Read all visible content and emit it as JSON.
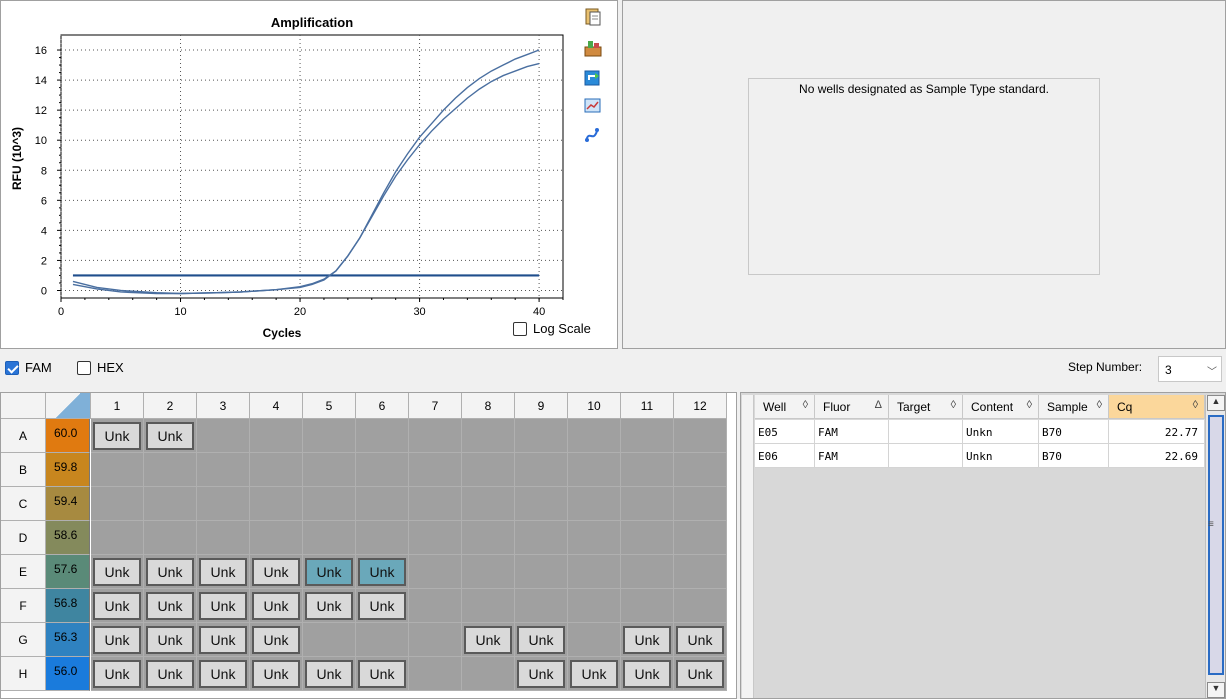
{
  "chart": {
    "title": "Amplification",
    "xlabel": "Cycles",
    "ylabel": "RFU (10^3)",
    "x_ticks": [
      "0",
      "10",
      "20",
      "30",
      "40"
    ],
    "y_ticks": [
      "0",
      "2",
      "4",
      "6",
      "8",
      "10",
      "12",
      "14",
      "16"
    ],
    "log_scale_label": "Log Scale",
    "log_scale_checked": false
  },
  "chart_data": {
    "type": "line",
    "title": "Amplification",
    "xlabel": "Cycles",
    "ylabel": "RFU (10^3)",
    "xlim": [
      0,
      42
    ],
    "ylim": [
      -0.5,
      17
    ],
    "grid": true,
    "threshold": 1.0,
    "series": [
      {
        "x": [
          1,
          3,
          5,
          8,
          10,
          13,
          15,
          18,
          20,
          21,
          22,
          23,
          24,
          25,
          26,
          27,
          28,
          29,
          30,
          31,
          32,
          33,
          34,
          35,
          36,
          37,
          38,
          39,
          40
        ],
        "values": [
          0.4,
          0.1,
          -0.1,
          -0.2,
          -0.2,
          -0.15,
          -0.1,
          0.05,
          0.2,
          0.4,
          0.7,
          1.3,
          2.3,
          3.5,
          5.0,
          6.5,
          7.9,
          9.1,
          10.2,
          11.1,
          12.0,
          12.8,
          13.5,
          14.1,
          14.6,
          15.0,
          15.4,
          15.7,
          16.0
        ]
      },
      {
        "x": [
          1,
          3,
          5,
          8,
          10,
          13,
          15,
          18,
          20,
          21,
          22,
          23,
          24,
          25,
          26,
          27,
          28,
          29,
          30,
          31,
          32,
          33,
          34,
          35,
          36,
          37,
          38,
          39,
          40
        ],
        "values": [
          0.6,
          0.2,
          0.0,
          -0.15,
          -0.2,
          -0.15,
          -0.1,
          0.05,
          0.25,
          0.45,
          0.75,
          1.3,
          2.3,
          3.5,
          4.9,
          6.3,
          7.6,
          8.7,
          9.7,
          10.6,
          11.4,
          12.1,
          12.8,
          13.4,
          13.9,
          14.3,
          14.6,
          14.9,
          15.1
        ]
      }
    ]
  },
  "toolbar_icons": [
    "copy-icon",
    "export-icon",
    "rotate-icon",
    "chart-zoom-icon",
    "trace-icon"
  ],
  "standard_curve": {
    "message": "No wells designated as Sample Type standard."
  },
  "fluors": [
    {
      "label": "FAM",
      "checked": true
    },
    {
      "label": "HEX",
      "checked": false
    }
  ],
  "step": {
    "label": "Step Number:",
    "value": "3"
  },
  "plate": {
    "columns": [
      "1",
      "2",
      "3",
      "4",
      "5",
      "6",
      "7",
      "8",
      "9",
      "10",
      "11",
      "12"
    ],
    "rows": [
      {
        "label": "A",
        "temp": "60.0",
        "color": "#e07a10",
        "wells": [
          "Unk",
          "Unk",
          "",
          "",
          "",
          "",
          "",
          "",
          "",
          "",
          "",
          ""
        ]
      },
      {
        "label": "B",
        "temp": "59.8",
        "color": "#c8861e",
        "wells": [
          "",
          "",
          "",
          "",
          "",
          "",
          "",
          "",
          "",
          "",
          "",
          ""
        ]
      },
      {
        "label": "C",
        "temp": "59.4",
        "color": "#a78a40",
        "wells": [
          "",
          "",
          "",
          "",
          "",
          "",
          "",
          "",
          "",
          "",
          "",
          ""
        ]
      },
      {
        "label": "D",
        "temp": "58.6",
        "color": "#848a5c",
        "wells": [
          "",
          "",
          "",
          "",
          "",
          "",
          "",
          "",
          "",
          "",
          "",
          ""
        ]
      },
      {
        "label": "E",
        "temp": "57.6",
        "color": "#5a8a78",
        "wells": [
          "Unk",
          "Unk",
          "Unk",
          "Unk",
          "Unk*",
          "Unk*",
          "",
          "",
          "",
          "",
          "",
          ""
        ]
      },
      {
        "label": "F",
        "temp": "56.8",
        "color": "#3f85a0",
        "wells": [
          "Unk",
          "Unk",
          "Unk",
          "Unk",
          "Unk",
          "Unk",
          "",
          "",
          "",
          "",
          "",
          ""
        ]
      },
      {
        "label": "G",
        "temp": "56.3",
        "color": "#2f82c0",
        "wells": [
          "Unk",
          "Unk",
          "Unk",
          "Unk",
          "",
          "",
          "",
          "Unk",
          "Unk",
          "",
          "Unk",
          "Unk"
        ]
      },
      {
        "label": "H",
        "temp": "56.0",
        "color": "#1a7bdc",
        "wells": [
          "Unk",
          "Unk",
          "Unk",
          "Unk",
          "Unk",
          "Unk",
          "",
          "",
          "Unk",
          "Unk",
          "Unk",
          "Unk"
        ]
      }
    ]
  },
  "results": {
    "headers": [
      "Well",
      "Fluor",
      "Target",
      "Content",
      "Sample",
      "Cq"
    ],
    "sort_marks": [
      "◊",
      "Δ",
      "◊",
      "◊",
      "◊",
      "◊"
    ],
    "active_header": "Cq",
    "rows": [
      [
        "E05",
        "FAM",
        "",
        "Unkn",
        "B70",
        "22.77"
      ],
      [
        "E06",
        "FAM",
        "",
        "Unkn",
        "B70",
        "22.69"
      ]
    ]
  }
}
